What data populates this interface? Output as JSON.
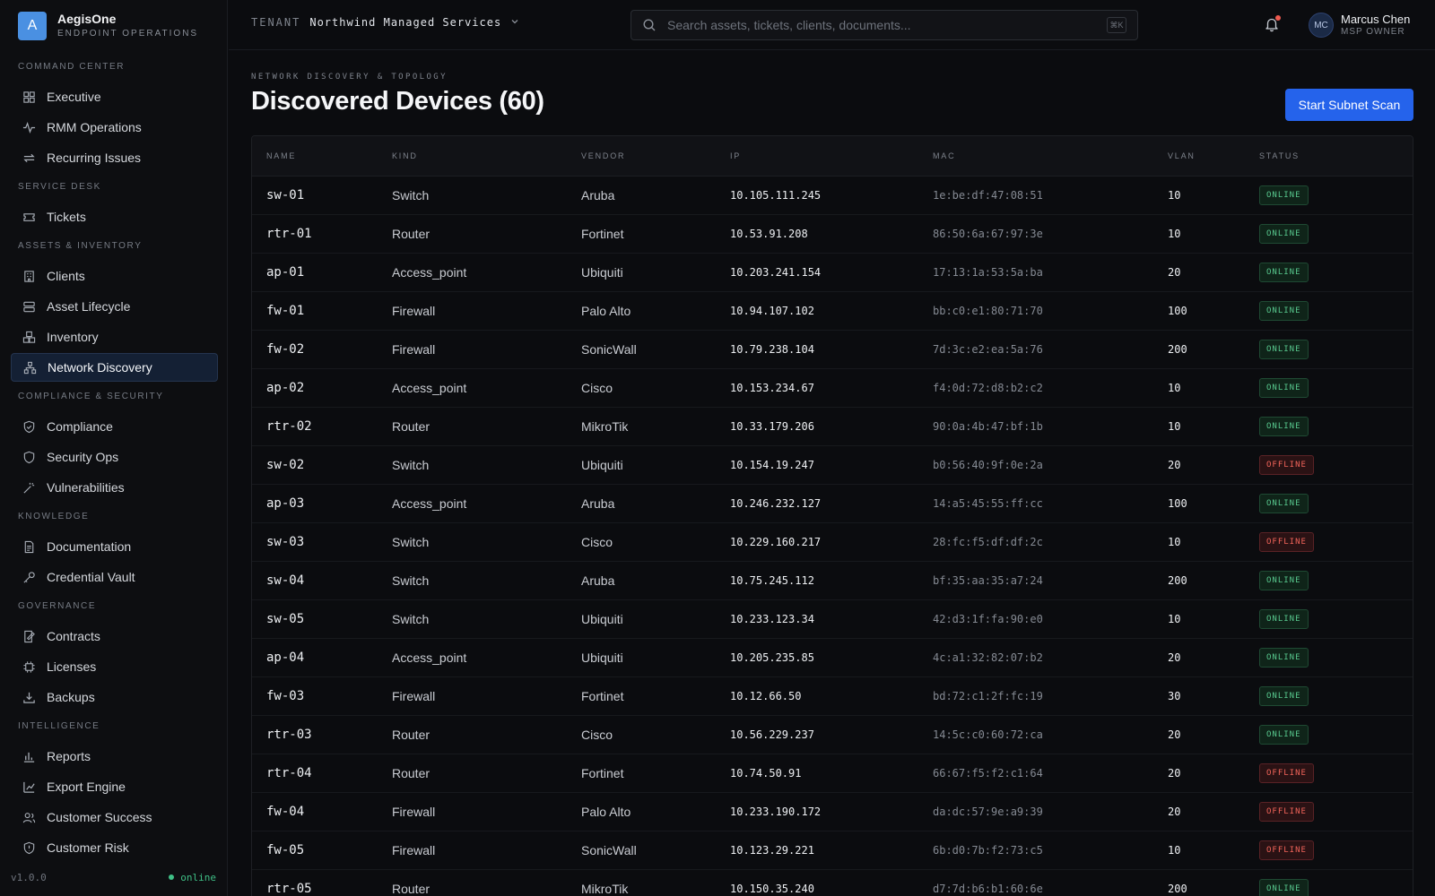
{
  "brand": {
    "logo_letter": "A",
    "name": "AegisOne",
    "subtitle": "ENDPOINT OPERATIONS"
  },
  "nav": [
    {
      "section": "COMMAND CENTER",
      "items": [
        {
          "label": "Executive",
          "icon": "grid-icon"
        },
        {
          "label": "RMM Operations",
          "icon": "pulse-icon"
        },
        {
          "label": "Recurring Issues",
          "icon": "repeat-icon"
        }
      ]
    },
    {
      "section": "SERVICE DESK",
      "items": [
        {
          "label": "Tickets",
          "icon": "ticket-icon"
        }
      ]
    },
    {
      "section": "ASSETS & INVENTORY",
      "items": [
        {
          "label": "Clients",
          "icon": "building-icon"
        },
        {
          "label": "Asset Lifecycle",
          "icon": "server-icon"
        },
        {
          "label": "Inventory",
          "icon": "boxes-icon"
        },
        {
          "label": "Network Discovery",
          "icon": "network-icon",
          "active": true
        }
      ]
    },
    {
      "section": "COMPLIANCE & SECURITY",
      "items": [
        {
          "label": "Compliance",
          "icon": "shield-check-icon"
        },
        {
          "label": "Security Ops",
          "icon": "shield-icon"
        },
        {
          "label": "Vulnerabilities",
          "icon": "wand-icon"
        }
      ]
    },
    {
      "section": "KNOWLEDGE",
      "items": [
        {
          "label": "Documentation",
          "icon": "document-icon"
        },
        {
          "label": "Credential Vault",
          "icon": "key-icon"
        }
      ]
    },
    {
      "section": "GOVERNANCE",
      "items": [
        {
          "label": "Contracts",
          "icon": "contract-icon"
        },
        {
          "label": "Licenses",
          "icon": "chip-icon"
        },
        {
          "label": "Backups",
          "icon": "download-icon"
        }
      ]
    },
    {
      "section": "INTELLIGENCE",
      "items": [
        {
          "label": "Reports",
          "icon": "bar-chart-icon"
        },
        {
          "label": "Export Engine",
          "icon": "export-icon"
        },
        {
          "label": "Customer Success",
          "icon": "users-icon"
        },
        {
          "label": "Customer Risk",
          "icon": "shield-alert-icon"
        }
      ]
    }
  ],
  "footer": {
    "version": "v1.0.0",
    "status": "online"
  },
  "topbar": {
    "tenant_label": "TENANT",
    "tenant_name": "Northwind Managed Services",
    "search_placeholder": "Search assets, tickets, clients, documents...",
    "search_shortcut": "⌘K",
    "user": {
      "initials": "MC",
      "name": "Marcus Chen",
      "role": "MSP OWNER"
    }
  },
  "page": {
    "eyebrow": "NETWORK DISCOVERY & TOPOLOGY",
    "title": "Discovered Devices (60)",
    "primary_action": "Start Subnet Scan"
  },
  "table": {
    "columns": [
      "NAME",
      "KIND",
      "VENDOR",
      "IP",
      "MAC",
      "VLAN",
      "STATUS"
    ],
    "rows": [
      {
        "name": "sw-01",
        "kind": "Switch",
        "vendor": "Aruba",
        "ip": "10.105.111.245",
        "mac": "1e:be:df:47:08:51",
        "vlan": "10",
        "status": "ONLINE"
      },
      {
        "name": "rtr-01",
        "kind": "Router",
        "vendor": "Fortinet",
        "ip": "10.53.91.208",
        "mac": "86:50:6a:67:97:3e",
        "vlan": "10",
        "status": "ONLINE"
      },
      {
        "name": "ap-01",
        "kind": "Access_point",
        "vendor": "Ubiquiti",
        "ip": "10.203.241.154",
        "mac": "17:13:1a:53:5a:ba",
        "vlan": "20",
        "status": "ONLINE"
      },
      {
        "name": "fw-01",
        "kind": "Firewall",
        "vendor": "Palo Alto",
        "ip": "10.94.107.102",
        "mac": "bb:c0:e1:80:71:70",
        "vlan": "100",
        "status": "ONLINE"
      },
      {
        "name": "fw-02",
        "kind": "Firewall",
        "vendor": "SonicWall",
        "ip": "10.79.238.104",
        "mac": "7d:3c:e2:ea:5a:76",
        "vlan": "200",
        "status": "ONLINE"
      },
      {
        "name": "ap-02",
        "kind": "Access_point",
        "vendor": "Cisco",
        "ip": "10.153.234.67",
        "mac": "f4:0d:72:d8:b2:c2",
        "vlan": "10",
        "status": "ONLINE"
      },
      {
        "name": "rtr-02",
        "kind": "Router",
        "vendor": "MikroTik",
        "ip": "10.33.179.206",
        "mac": "90:0a:4b:47:bf:1b",
        "vlan": "10",
        "status": "ONLINE"
      },
      {
        "name": "sw-02",
        "kind": "Switch",
        "vendor": "Ubiquiti",
        "ip": "10.154.19.247",
        "mac": "b0:56:40:9f:0e:2a",
        "vlan": "20",
        "status": "OFFLINE"
      },
      {
        "name": "ap-03",
        "kind": "Access_point",
        "vendor": "Aruba",
        "ip": "10.246.232.127",
        "mac": "14:a5:45:55:ff:cc",
        "vlan": "100",
        "status": "ONLINE"
      },
      {
        "name": "sw-03",
        "kind": "Switch",
        "vendor": "Cisco",
        "ip": "10.229.160.217",
        "mac": "28:fc:f5:df:df:2c",
        "vlan": "10",
        "status": "OFFLINE"
      },
      {
        "name": "sw-04",
        "kind": "Switch",
        "vendor": "Aruba",
        "ip": "10.75.245.112",
        "mac": "bf:35:aa:35:a7:24",
        "vlan": "200",
        "status": "ONLINE"
      },
      {
        "name": "sw-05",
        "kind": "Switch",
        "vendor": "Ubiquiti",
        "ip": "10.233.123.34",
        "mac": "42:d3:1f:fa:90:e0",
        "vlan": "10",
        "status": "ONLINE"
      },
      {
        "name": "ap-04",
        "kind": "Access_point",
        "vendor": "Ubiquiti",
        "ip": "10.205.235.85",
        "mac": "4c:a1:32:82:07:b2",
        "vlan": "20",
        "status": "ONLINE"
      },
      {
        "name": "fw-03",
        "kind": "Firewall",
        "vendor": "Fortinet",
        "ip": "10.12.66.50",
        "mac": "bd:72:c1:2f:fc:19",
        "vlan": "30",
        "status": "ONLINE"
      },
      {
        "name": "rtr-03",
        "kind": "Router",
        "vendor": "Cisco",
        "ip": "10.56.229.237",
        "mac": "14:5c:c0:60:72:ca",
        "vlan": "20",
        "status": "ONLINE"
      },
      {
        "name": "rtr-04",
        "kind": "Router",
        "vendor": "Fortinet",
        "ip": "10.74.50.91",
        "mac": "66:67:f5:f2:c1:64",
        "vlan": "20",
        "status": "OFFLINE"
      },
      {
        "name": "fw-04",
        "kind": "Firewall",
        "vendor": "Palo Alto",
        "ip": "10.233.190.172",
        "mac": "da:dc:57:9e:a9:39",
        "vlan": "20",
        "status": "OFFLINE"
      },
      {
        "name": "fw-05",
        "kind": "Firewall",
        "vendor": "SonicWall",
        "ip": "10.123.29.221",
        "mac": "6b:d0:7b:f2:73:c5",
        "vlan": "10",
        "status": "OFFLINE"
      },
      {
        "name": "rtr-05",
        "kind": "Router",
        "vendor": "MikroTik",
        "ip": "10.150.35.240",
        "mac": "d7:7d:b6:b1:60:6e",
        "vlan": "200",
        "status": "ONLINE"
      }
    ]
  },
  "colors": {
    "accent": "#2563eb",
    "online": "#58c98e",
    "offline": "#f2645a",
    "brand": "#4a90e2"
  }
}
